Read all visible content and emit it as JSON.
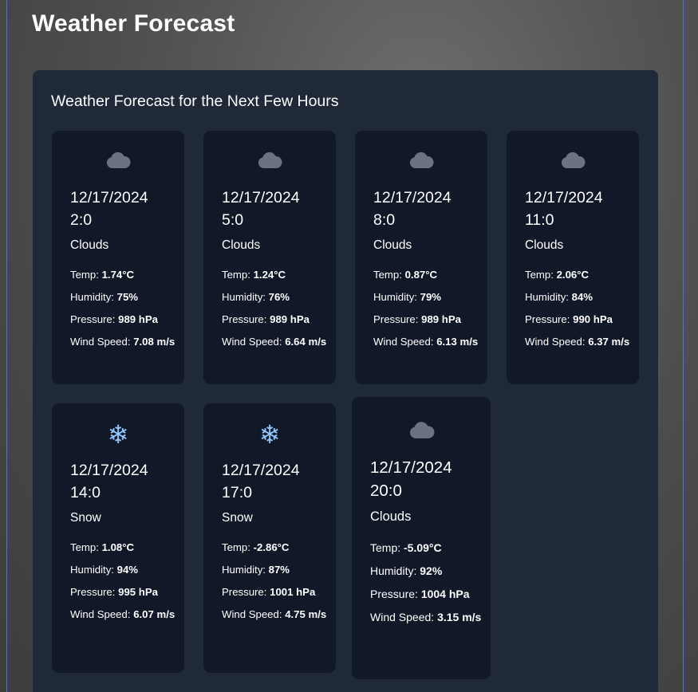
{
  "page": {
    "title": "Weather Forecast"
  },
  "panel": {
    "title": "Weather Forecast for the Next Few Hours"
  },
  "labels": {
    "temp": "Temp:",
    "humidity": "Humidity:",
    "pressure": "Pressure:",
    "wind": "Wind Speed:"
  },
  "forecasts": [
    {
      "date": "12/17/2024",
      "time": "2:0",
      "condition": "Clouds",
      "icon": "cloud-icon",
      "temp": "1.74°C",
      "humidity": "75%",
      "pressure": "989 hPa",
      "wind": "7.08 m/s"
    },
    {
      "date": "12/17/2024",
      "time": "5:0",
      "condition": "Clouds",
      "icon": "cloud-icon",
      "temp": "1.24°C",
      "humidity": "76%",
      "pressure": "989 hPa",
      "wind": "6.64 m/s"
    },
    {
      "date": "12/17/2024",
      "time": "8:0",
      "condition": "Clouds",
      "icon": "cloud-icon",
      "temp": "0.87°C",
      "humidity": "79%",
      "pressure": "989 hPa",
      "wind": "6.13 m/s"
    },
    {
      "date": "12/17/2024",
      "time": "11:0",
      "condition": "Clouds",
      "icon": "cloud-icon",
      "temp": "2.06°C",
      "humidity": "84%",
      "pressure": "990 hPa",
      "wind": "6.37 m/s"
    },
    {
      "date": "12/17/2024",
      "time": "14:0",
      "condition": "Snow",
      "icon": "snowflake-icon",
      "temp": "1.08°C",
      "humidity": "94%",
      "pressure": "995 hPa",
      "wind": "6.07 m/s"
    },
    {
      "date": "12/17/2024",
      "time": "17:0",
      "condition": "Snow",
      "icon": "snowflake-icon",
      "temp": "-2.86°C",
      "humidity": "87%",
      "pressure": "1001 hPa",
      "wind": "4.75 m/s"
    },
    {
      "date": "12/17/2024",
      "time": "20:0",
      "condition": "Clouds",
      "icon": "cloud-icon",
      "temp": "-5.09°C",
      "humidity": "92%",
      "pressure": "1004 hPa",
      "wind": "3.15 m/s"
    }
  ],
  "colors": {
    "panel_bg": "#1f2937",
    "card_bg": "#111827",
    "cloud_icon": "#6b7280",
    "snow_icon": "#93c5fd"
  }
}
